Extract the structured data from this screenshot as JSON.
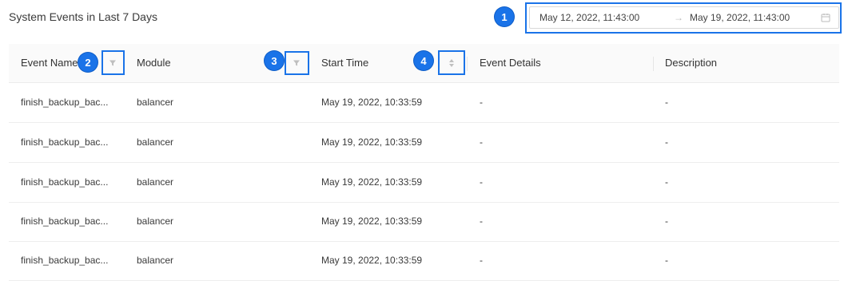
{
  "page_title": "System Events in Last 7 Days",
  "date_range": {
    "start": "May 12, 2022, 11:43:00",
    "separator": "→",
    "end": "May 19, 2022, 11:43:00"
  },
  "badges": [
    "1",
    "2",
    "3",
    "4"
  ],
  "columns": [
    "Event Name",
    "Module",
    "Start Time",
    "Event Details",
    "Description"
  ],
  "rows": [
    {
      "event_name": "finish_backup_bac...",
      "module": "balancer",
      "start_time": "May 19, 2022, 10:33:59",
      "details": "-",
      "description": "-"
    },
    {
      "event_name": "finish_backup_bac...",
      "module": "balancer",
      "start_time": "May 19, 2022, 10:33:59",
      "details": "-",
      "description": "-"
    },
    {
      "event_name": "finish_backup_bac...",
      "module": "balancer",
      "start_time": "May 19, 2022, 10:33:59",
      "details": "-",
      "description": "-"
    },
    {
      "event_name": "finish_backup_bac...",
      "module": "balancer",
      "start_time": "May 19, 2022, 10:33:59",
      "details": "-",
      "description": "-"
    },
    {
      "event_name": "finish_backup_bac...",
      "module": "balancer",
      "start_time": "May 19, 2022, 10:33:59",
      "details": "-",
      "description": "-"
    }
  ],
  "colors": {
    "accent": "#1a73e8",
    "header_bg": "#fafafa"
  },
  "icons": [
    "filter-icon",
    "sort-icon",
    "calendar-icon"
  ]
}
